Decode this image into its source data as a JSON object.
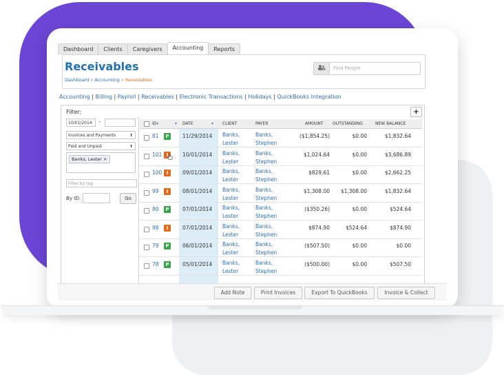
{
  "colors": {
    "accent": "#1f6fb2",
    "link": "#2a6ebb",
    "orange": "#e06a1e",
    "green": "#3aa64b",
    "highlight": "#dcedf8",
    "purple": "#6b46d6"
  },
  "tabs": [
    "Dashboard",
    "Clients",
    "Caregivers",
    "Accounting",
    "Reports"
  ],
  "active_tab": "Accounting",
  "page_title": "Receivables",
  "breadcrumb": {
    "items": [
      "Dashboard",
      "Accounting",
      "Receivables"
    ],
    "sep": "»"
  },
  "search": {
    "placeholder": "Find People",
    "icon": "people-icon"
  },
  "subnav": [
    "Accounting",
    "Billing",
    "Payroll",
    "Receivables",
    "Electronic Transactions",
    "Holidays",
    "QuickBooks Integration"
  ],
  "filter": {
    "label": "Filter:",
    "date_from": "10/01/2014",
    "date_sep": "-",
    "type_select": "Invoices and Payments",
    "status_select": "Paid and Unpaid",
    "client_chip": "Banks, Lester",
    "chip_remove": "×",
    "tag_placeholder": "Filter by tag",
    "by_id_label": "By ID:",
    "go": "Go",
    "add_button": "+"
  },
  "table": {
    "columns": [
      "ID",
      "DATE",
      "CLIENT",
      "PAYER",
      "AMOUNT",
      "OUTSTANDING",
      "NEW BALANCE"
    ],
    "rows": [
      {
        "id": "81",
        "type": "P",
        "date": "11/29/2014",
        "client": [
          "Banks,",
          "Lester"
        ],
        "payer": [
          "Banks,",
          "Stephen"
        ],
        "amount": "($1,854.25)",
        "outstanding": "$0.00",
        "balance": "$1,832.64"
      },
      {
        "id": "101",
        "type": "I",
        "date": "10/01/2014",
        "client": [
          "Banks,",
          "Lester"
        ],
        "payer": [
          "Banks,",
          "Stephen"
        ],
        "amount": "$1,024.64",
        "outstanding": "$0.00",
        "balance": "$3,686.89"
      },
      {
        "id": "100",
        "type": "I",
        "date": "09/01/2014",
        "client": [
          "Banks,",
          "Lester"
        ],
        "payer": [
          "Banks,",
          "Stephen"
        ],
        "amount": "$829.61",
        "outstanding": "$0.00",
        "balance": "$2,662.25"
      },
      {
        "id": "99",
        "type": "I",
        "date": "08/01/2014",
        "client": [
          "Banks,",
          "Lester"
        ],
        "payer": [
          "Banks,",
          "Stephen"
        ],
        "amount": "$1,308.00",
        "outstanding": "$1,308.00",
        "balance": "$1,832.64"
      },
      {
        "id": "80",
        "type": "P",
        "date": "07/01/2014",
        "client": [
          "Banks,",
          "Lester"
        ],
        "payer": [
          "Banks,",
          "Stephen"
        ],
        "amount": "($350.26)",
        "outstanding": "$0.00",
        "balance": "$524.64"
      },
      {
        "id": "98",
        "type": "I",
        "date": "07/01/2014",
        "client": [
          "Banks,",
          "Lester"
        ],
        "payer": [
          "Banks,",
          "Stephen"
        ],
        "amount": "$874.90",
        "outstanding": "$524.64",
        "balance": "$874.90"
      },
      {
        "id": "79",
        "type": "P",
        "date": "06/01/2014",
        "client": [
          "Banks,",
          "Lester"
        ],
        "payer": [
          "Banks,",
          "Stephen"
        ],
        "amount": "($507.50)",
        "outstanding": "$0.00",
        "balance": "$0.00"
      },
      {
        "id": "78",
        "type": "P",
        "date": "05/01/2014",
        "client": [
          "Banks,",
          "Lester"
        ],
        "payer": [
          "Banks,",
          "Stephen"
        ],
        "amount": "($500.00)",
        "outstanding": "$0.00",
        "balance": "$507.50"
      }
    ]
  },
  "footer_buttons": [
    "Add Note",
    "Print Invoices",
    "Export To QuickBooks",
    "Invoice & Collect"
  ]
}
